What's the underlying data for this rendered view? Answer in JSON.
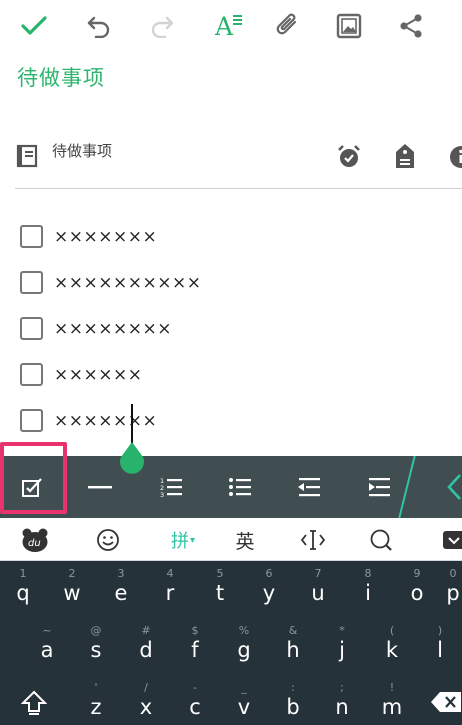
{
  "toolbar": {
    "icons": [
      "check-icon",
      "undo-icon",
      "redo-icon",
      "text-format-icon",
      "attachment-icon",
      "image-icon",
      "share-icon"
    ]
  },
  "note": {
    "title": "待做事项",
    "notebook": "待做事项"
  },
  "colors": {
    "accent": "#27b36b",
    "highlight": "#e8336d",
    "keyboard": "#26323a",
    "format_bar": "#414e51"
  },
  "checklist": [
    {
      "text": "×××××××",
      "checked": false
    },
    {
      "text": "××××××××××",
      "checked": false
    },
    {
      "text": "××××××××",
      "checked": false
    },
    {
      "text": "××××××",
      "checked": false
    },
    {
      "text": "×××××××",
      "checked": false
    }
  ],
  "format_bar": {
    "buttons": [
      "checkbox-icon",
      "divider-line-icon",
      "numbered-list-icon",
      "bullet-list-icon",
      "outdent-icon",
      "indent-icon"
    ]
  },
  "keyboard": {
    "top": {
      "pinyin": "拼",
      "english": "英"
    },
    "row1": [
      {
        "hint": "1",
        "key": "q"
      },
      {
        "hint": "2",
        "key": "w"
      },
      {
        "hint": "3",
        "key": "e"
      },
      {
        "hint": "4",
        "key": "r"
      },
      {
        "hint": "5",
        "key": "t"
      },
      {
        "hint": "6",
        "key": "y"
      },
      {
        "hint": "7",
        "key": "u"
      },
      {
        "hint": "8",
        "key": "i"
      },
      {
        "hint": "9",
        "key": "o"
      },
      {
        "hint": "0",
        "key": "p"
      }
    ],
    "row2": [
      {
        "hint": "~",
        "key": "a"
      },
      {
        "hint": "@",
        "key": "s"
      },
      {
        "hint": "#",
        "key": "d"
      },
      {
        "hint": "$",
        "key": "f"
      },
      {
        "hint": "%",
        "key": "g"
      },
      {
        "hint": "&",
        "key": "h"
      },
      {
        "hint": "*",
        "key": "j"
      },
      {
        "hint": "(",
        "key": "k"
      },
      {
        "hint": ")",
        "key": "l"
      }
    ],
    "row3": [
      {
        "hint": "'",
        "key": "z"
      },
      {
        "hint": "/",
        "key": "x"
      },
      {
        "hint": "-",
        "key": "c"
      },
      {
        "hint": "_",
        "key": "v"
      },
      {
        "hint": ":",
        "key": "b"
      },
      {
        "hint": ";",
        "key": "n"
      },
      {
        "hint": "!",
        "key": "m"
      }
    ]
  }
}
